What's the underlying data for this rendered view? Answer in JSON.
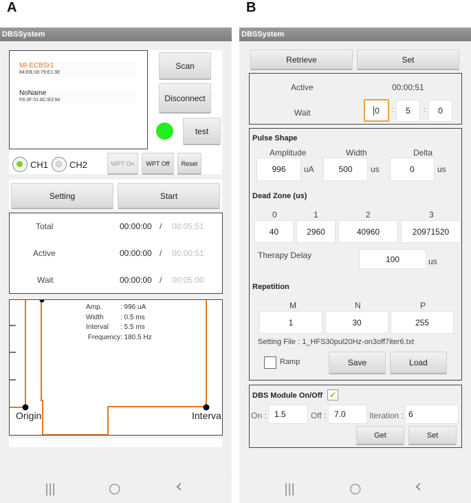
{
  "panels": {
    "a": "A",
    "b": "B"
  },
  "app_title": "DBSSystem",
  "screen_a": {
    "devices": [
      {
        "name": "MI-ECBSr1",
        "mac": "84:EB:18:79:E1:3E",
        "selected": true
      },
      {
        "name": "NoName",
        "mac": "F8:3F:51:8C:B3:94",
        "selected": false
      }
    ],
    "buttons": {
      "scan": "Scan",
      "disconnect": "Disconnect",
      "test": "test",
      "wpt_on": "WPT On",
      "wpt_off": "WPT Off",
      "reset": "Reset",
      "setting": "Setting",
      "start": "Start"
    },
    "status_indicator_color": "#22ee22",
    "channels": [
      {
        "label": "CH1",
        "checked": true
      },
      {
        "label": "CH2",
        "checked": false
      }
    ],
    "timers": [
      {
        "label": "Total",
        "elapsed": "00:00:00",
        "sep": "/",
        "total": "00:05:51"
      },
      {
        "label": "Active",
        "elapsed": "00:00:00",
        "sep": "/",
        "total": "00:00:51"
      },
      {
        "label": "Wait",
        "elapsed": "00:00:00",
        "sep": "/",
        "total": "00:05:00"
      }
    ],
    "waveform": {
      "info": [
        {
          "key": "Amp.",
          "value": ": 996 uA"
        },
        {
          "key": "Width",
          "value": ": 0.5 ms"
        },
        {
          "key": "Interval",
          "value": ": 5.5 ms"
        },
        {
          "key": "Frequency",
          "value": ": 180.5 Hz"
        }
      ],
      "origin_label": "Origin",
      "interval_label": "Interva",
      "line_color": "#e8761e"
    }
  },
  "screen_b": {
    "buttons": {
      "retrieve": "Retrieve",
      "set": "Set",
      "save": "Save",
      "load": "Load",
      "get": "Get",
      "set2": "Set"
    },
    "active_label": "Active",
    "active_value": "00:00:51",
    "wait_label": "Wait",
    "wait_fields": [
      "0",
      "5",
      "0"
    ],
    "colon": ":",
    "pulse_shape": {
      "title": "Pulse Shape",
      "fields": [
        {
          "label": "Amplitude",
          "value": "996",
          "unit": "uA"
        },
        {
          "label": "Width",
          "value": "500",
          "unit": "us"
        },
        {
          "label": "Delta",
          "value": "0",
          "unit": "us"
        }
      ]
    },
    "dead_zone": {
      "title": "Dead Zone (us)",
      "fields": [
        {
          "label": "0",
          "value": "40"
        },
        {
          "label": "1",
          "value": "2960"
        },
        {
          "label": "2",
          "value": "40960"
        },
        {
          "label": "3",
          "value": "20971520"
        }
      ],
      "therapy_delay_label": "Therapy Delay",
      "therapy_delay_value": "100",
      "therapy_delay_unit": "us"
    },
    "repetition": {
      "title": "Repetition",
      "fields": [
        {
          "label": "M",
          "value": "1"
        },
        {
          "label": "N",
          "value": "30"
        },
        {
          "label": "P",
          "value": "255"
        }
      ],
      "setting_file": "Setting File : 1_HFS30pul20Hz-on3off7iter6.txt",
      "ramp_label": "Ramp",
      "ramp_checked": false
    },
    "dbs_module": {
      "title": "DBS Module On/Off",
      "enabled": true,
      "on_label": "On :",
      "on_value": "1.5",
      "off_label": "Off :",
      "off_value": "7.0",
      "iteration_label": "Iteration :",
      "iteration_value": "6"
    }
  },
  "nav": {
    "recents": "|||",
    "home": "○",
    "back": "‹"
  }
}
